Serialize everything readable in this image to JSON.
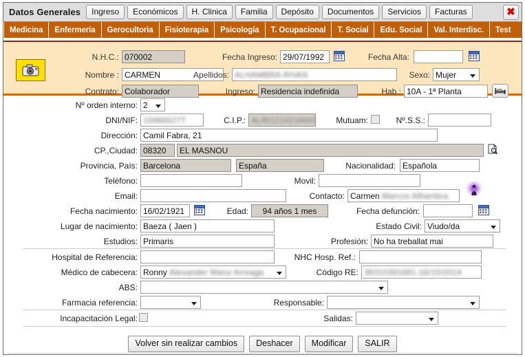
{
  "window": {
    "title": "Datos Generales",
    "close_label": "✕"
  },
  "top_tabs": [
    {
      "label": "Ingreso"
    },
    {
      "label": "Económicos"
    },
    {
      "label": "H. Clinica"
    },
    {
      "label": "Familia"
    },
    {
      "label": "Depósito"
    },
    {
      "label": "Documentos"
    },
    {
      "label": "Servicios"
    },
    {
      "label": "Facturas"
    }
  ],
  "sub_tabs": [
    {
      "label": "Medicina"
    },
    {
      "label": "Enfermería"
    },
    {
      "label": "Gerocultoria"
    },
    {
      "label": "Fisioterapia"
    },
    {
      "label": "Psicología"
    },
    {
      "label": "T. Ocupacional"
    },
    {
      "label": "T. Social"
    },
    {
      "label": "Edu. Social"
    },
    {
      "label": "Val. Interdisc."
    },
    {
      "label": "Test"
    }
  ],
  "patient_header": {
    "photo_icon": "camera-icon",
    "nhc_label": "N.H.C.:",
    "nhc_value": "070002",
    "fecha_ingreso_label": "Fecha Ingreso:",
    "fecha_ingreso_value": "29/07/1992",
    "fecha_alta_label": "Fecha Alta:",
    "fecha_alta_value": "",
    "nombre_label": "Nombre :",
    "nombre_value": "CARMEN",
    "apellidos_label": "Apellidos:",
    "apellidos_value": "ALHAMBRA RIVAS",
    "sexo_label": "Sexo:",
    "sexo_value": "Mujer",
    "contrato_label": "Contrato:",
    "contrato_value": "Colaborador",
    "ingreso_label": "Ingreso:",
    "ingreso_value": "Residencia indefinida",
    "hab_label": "Hab.:",
    "hab_value": "10A - 1ª Planta",
    "bed_icon": "bed-icon"
  },
  "form": {
    "orden_interno_label": "Nº orden interno:",
    "orden_interno_value": "2",
    "dni_label": "DNI/NIF:",
    "dni_value": "15966527T",
    "cip_label": "C.I.P.:",
    "cip_value": "ALRI1210216003",
    "mutuam_label": "Mutuam:",
    "mutuam_checked": false,
    "nss_label": "Nº.S.S.:",
    "nss_value": "",
    "direccion_label": "Dirección:",
    "direccion_value": "Camil Fabra, 21",
    "cp_ciudad_label": "CP.,Ciudad:",
    "cp_value": "08320",
    "ciudad_value": "EL MASNOU",
    "ciudad_search_icon": "document-search-icon",
    "provincia_pais_label": "Provincia, País:",
    "provincia_value": "Barcelona",
    "pais_value": "España",
    "nacionalidad_label": "Nacionalidad:",
    "nacionalidad_value": "Española",
    "telefono_label": "Teléfono:",
    "telefono_value": "",
    "movil_label": "Movil:",
    "movil_value": "",
    "email_label": "Email:",
    "email_value": "",
    "contacto_label": "Contacto:",
    "contacto_value_visible": "Carmen ",
    "contacto_value_blurred": "Marcos Alhambra",
    "contacto_icon": "contact-broadcast-icon",
    "fecha_nacimiento_label": "Fecha nacimiento:",
    "fecha_nacimiento_value": "16/02/1921",
    "edad_label": "Edad:",
    "edad_value": "94 años 1 mes",
    "fecha_defuncion_label": "Fecha defunción:",
    "fecha_defuncion_value": "",
    "lugar_nacimiento_label": "Lugar de nacimiento:",
    "lugar_nacimiento_value": "Baeza ( Jaen )",
    "estado_civil_label": "Estado Civil:",
    "estado_civil_value": "Viudo/da",
    "estudios_label": "Estudios:",
    "estudios_value": "Primaris",
    "profesion_label": "Profesión:",
    "profesion_value": "No ha treballat mai",
    "hospital_ref_label": "Hospital de Referencia:",
    "hospital_ref_value": "",
    "nhc_hosp_ref_label": "NHC Hosp. Ref.:",
    "nhc_hosp_ref_value": "",
    "medico_cabecera_label": "Médico de cabecera:",
    "medico_visible": "Ronny ",
    "medico_blurred": "Alexander Marui Arreaga",
    "codigo_re_label": "Código RE:",
    "codigo_re_value": "36310391681-16/10/2014",
    "abs_label": "ABS:",
    "abs_value": "",
    "farmacia_label": "Farmacia referencia:",
    "farmacia_value": "",
    "responsable_label": "Responsable:",
    "responsable_value": "",
    "incapacitacion_label": "Incapacitación Legal:",
    "incapacitacion_checked": false,
    "salidas_label": "Salidas:",
    "salidas_value": "",
    "calendar_icon": "calendar-icon"
  },
  "actions": [
    {
      "label": "Volver sin realizar cambios"
    },
    {
      "label": "Deshacer"
    },
    {
      "label": "Modificar"
    },
    {
      "label": "SALIR"
    }
  ],
  "colors": {
    "orange_bar": "#c25d08",
    "header_panel": "#fde5bd",
    "header_rule": "#d06a10",
    "close_red": "#e00000",
    "photo_yellow": "#ffe000"
  }
}
